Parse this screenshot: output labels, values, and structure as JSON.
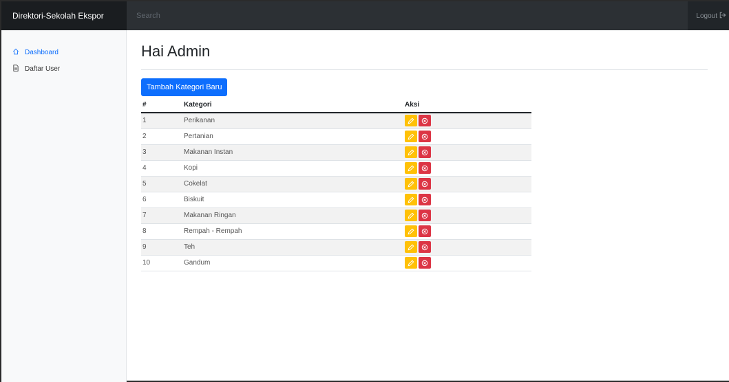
{
  "navbar": {
    "brand": "Direktori-Sekolah Ekspor",
    "search_placeholder": "Search",
    "logout_label": "Logout"
  },
  "sidebar": {
    "items": [
      {
        "label": "Dashboard",
        "icon": "home-icon",
        "active": true
      },
      {
        "label": "Daftar User",
        "icon": "file-icon",
        "active": false
      }
    ]
  },
  "main": {
    "title": "Hai Admin",
    "add_button": "Tambah Kategori Baru",
    "table": {
      "headers": [
        "#",
        "Kategori",
        "Aksi"
      ],
      "rows": [
        {
          "no": "1",
          "kategori": "Perikanan"
        },
        {
          "no": "2",
          "kategori": "Pertanian"
        },
        {
          "no": "3",
          "kategori": "Makanan Instan"
        },
        {
          "no": "4",
          "kategori": "Kopi"
        },
        {
          "no": "5",
          "kategori": "Cokelat"
        },
        {
          "no": "6",
          "kategori": "Biskuit"
        },
        {
          "no": "7",
          "kategori": "Makanan Ringan"
        },
        {
          "no": "8",
          "kategori": "Rempah - Rempah"
        },
        {
          "no": "9",
          "kategori": "Teh"
        },
        {
          "no": "10",
          "kategori": "Gandum"
        }
      ]
    }
  },
  "colors": {
    "navbar": "#212529",
    "primary": "#0d6efd",
    "warning": "#ffc107",
    "danger": "#dc3545"
  }
}
